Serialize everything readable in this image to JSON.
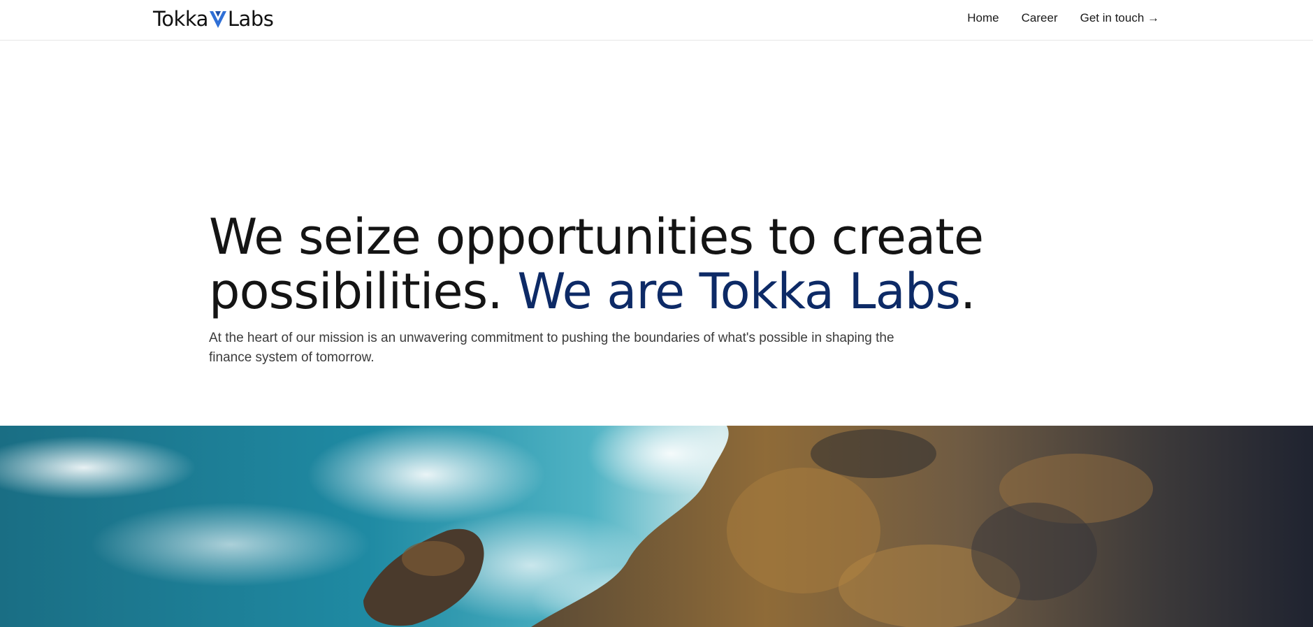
{
  "header": {
    "logo": {
      "text_left": "Tokka",
      "text_right": "Labs",
      "mark_icon": "tokka-v-mark-icon"
    },
    "nav": [
      {
        "label": "Home"
      },
      {
        "label": "Career"
      },
      {
        "label": "Get in touch →"
      }
    ]
  },
  "hero": {
    "headline_line1": "We seize opportunities to create",
    "headline_line2_start": "possibilities. ",
    "headline_accent": "We are Tokka Labs",
    "headline_end": ".",
    "subtext": "At the heart of our mission is an unwavering commitment to pushing the boundaries of what's possible in shaping the finance system of tomorrow."
  },
  "colors": {
    "accent": "#0d2a66",
    "logo_mark_blue": "#2f6fd6",
    "text": "#141414",
    "ocean": "#1f7f95",
    "rock": "#8a6a3b"
  }
}
